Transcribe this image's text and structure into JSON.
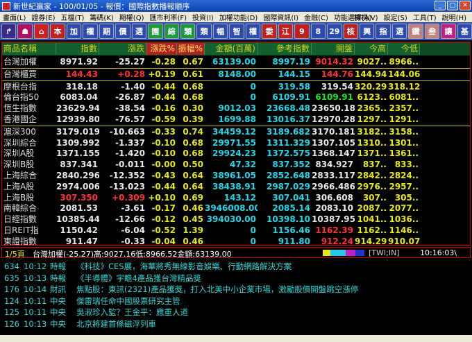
{
  "window": {
    "title": "新世紀贏家 - 100/01/05 - 報價：國際指數播報順序"
  },
  "menu": {
    "items": [
      "畫面(L)",
      "證券(E)",
      "五檔(T)",
      "籌碼(K)",
      "期權(Q)",
      "匯市利率(F)",
      "投資(I)",
      "加權功能(D)",
      "國際資訊(I)",
      "金融(C)",
      "功能選擇(A)"
    ],
    "right": [
      "檢視(V)",
      "設定(S)",
      "工具(T)",
      "說明(H)"
    ]
  },
  "toolbar": {
    "buttons": [
      {
        "label": "↱",
        "color": "#3a2a8a"
      },
      {
        "label": "☗",
        "color": "#b01060"
      },
      {
        "label": "⌂",
        "color": "#d02020"
      },
      {
        "label": "本",
        "color": "#c02020"
      },
      {
        "label": "加",
        "color": "#2c4bb0"
      },
      {
        "label": "權",
        "color": "#2c4bb0"
      },
      {
        "label": "期",
        "color": "#2c4bb0"
      },
      {
        "label": "價",
        "color": "#2c4bb0"
      },
      {
        "label": "選",
        "color": "#2c4bb0"
      },
      {
        "label": "園",
        "color": "#1a9a3a"
      },
      {
        "label": "綜",
        "color": "#1a9a3a"
      },
      {
        "label": "類",
        "color": "#1a9a3a"
      },
      {
        "label": "類",
        "color": "#2c4bb0"
      },
      {
        "label": "幅",
        "color": "#2c4bb0"
      },
      {
        "label": "智",
        "color": "#2c4bb0"
      },
      {
        "label": "權",
        "color": "#2c4bb0"
      },
      {
        "label": "委",
        "color": "#c02020"
      },
      {
        "label": "江",
        "color": "#c02020"
      },
      {
        "label": "9",
        "color": "#c02020"
      },
      {
        "label": "8",
        "color": "#2c4bb0"
      },
      {
        "label": "29",
        "color": "#2c4bb0"
      },
      {
        "label": "核",
        "color": "#c02020"
      },
      {
        "label": "興",
        "color": "#2c4bb0"
      },
      {
        "label": "指",
        "color": "#2c4bb0"
      },
      {
        "label": "選",
        "color": "#2c4bb0"
      },
      {
        "label": "鑽",
        "color": "#c08080"
      },
      {
        "label": "叁",
        "color": "#c08080"
      },
      {
        "label": "讓",
        "color": "#c02080"
      },
      {
        "label": "基",
        "color": "#2c4bb0"
      }
    ]
  },
  "table": {
    "headers": [
      "商品名稱",
      "指數",
      "漲跌",
      "漲跌%",
      "振幅%",
      "金額(百萬)",
      "參考指數",
      "開盤",
      "今高",
      "今低"
    ],
    "rows": [
      {
        "name": "台灣加權",
        "idx": "8971.92",
        "chg": "-25.27",
        "pct": "-0.28",
        "amp": "0.67",
        "amt": "63139.00",
        "ref": "8997.19",
        "open": "9014.32",
        "high": "9027..",
        "low": "8966..",
        "c": {
          "idx": "#e8e8e8",
          "chg": "#e8e8e8",
          "pct": "#e8e817",
          "amp": "#e8e817",
          "amt": "#20d8e8",
          "ref": "#20d8e8",
          "open": "#ff3333",
          "high": "#e8e817",
          "low": "#e8e817"
        }
      },
      {
        "name": "台灣櫃買",
        "idx": "144.43",
        "chg": "+0.28",
        "pct": "+0.19",
        "amp": "0.61",
        "amt": "8148.00",
        "ref": "144.15",
        "open": "144.76",
        "high": "144.94",
        "low": "144.06",
        "c": {
          "idx": "#ff3333",
          "chg": "#ff3333",
          "pct": "#e8e817",
          "amp": "#e8e817",
          "amt": "#20d8e8",
          "ref": "#20d8e8",
          "open": "#ff3333",
          "high": "#e8e817",
          "low": "#e8e817"
        }
      },
      {
        "name": "摩根台指",
        "idx": "318.18",
        "chg": "-1.40",
        "pct": "-0.44",
        "amp": "0.68",
        "amt": "0",
        "ref": "319.58",
        "open": "319.54",
        "high": "320.29",
        "low": "318.12",
        "c": {
          "idx": "#e8e8e8",
          "chg": "#e8e8e8",
          "pct": "#e8e817",
          "amp": "#e8e817",
          "amt": "#20d8e8",
          "ref": "#20d8e8",
          "open": "#e8e8e8",
          "high": "#e8e817",
          "low": "#e8e817"
        }
      },
      {
        "name": "倫台指50",
        "idx": "6083.04",
        "chg": "-26.87",
        "pct": "-0.44",
        "amp": "0.68",
        "amt": "0",
        "ref": "6109.91",
        "open": "6109.91",
        "high": "6123..",
        "low": "6081..",
        "c": {
          "idx": "#e8e8e8",
          "chg": "#e8e8e8",
          "pct": "#e8e817",
          "amp": "#e8e817",
          "amt": "#20d8e8",
          "ref": "#20d8e8",
          "open": "#22e822",
          "high": "#e8e817",
          "low": "#e8e817"
        }
      },
      {
        "name": "恆生指數",
        "idx": "23629.94",
        "chg": "-38.54",
        "pct": "-0.16",
        "amp": "0.30",
        "amt": "9012.03",
        "ref": "23668.48",
        "open": "23650.18",
        "high": "2365..",
        "low": "2357..",
        "c": {
          "idx": "#e8e8e8",
          "chg": "#e8e8e8",
          "pct": "#e8e817",
          "amp": "#e8e817",
          "amt": "#20d8e8",
          "ref": "#20d8e8",
          "open": "#e8e8e8",
          "high": "#e8e817",
          "low": "#e8e817"
        }
      },
      {
        "name": "香港國企",
        "idx": "12939.80",
        "chg": "-76.57",
        "pct": "-0.59",
        "amp": "0.39",
        "amt": "1699.88",
        "ref": "13016.37",
        "open": "12970.28",
        "high": "1297..",
        "low": "1291..",
        "c": {
          "idx": "#e8e8e8",
          "chg": "#e8e8e8",
          "pct": "#e8e817",
          "amp": "#e8e817",
          "amt": "#20d8e8",
          "ref": "#20d8e8",
          "open": "#e8e8e8",
          "high": "#e8e817",
          "low": "#e8e817"
        }
      },
      {
        "name": "滬深300",
        "idx": "3179.019",
        "chg": "-10.663",
        "pct": "-0.33",
        "amp": "0.74",
        "amt": "34459.12",
        "ref": "3189.682",
        "open": "3170.181",
        "high": "3182..",
        "low": "3158..",
        "c": {
          "idx": "#e8e8e8",
          "chg": "#e8e8e8",
          "pct": "#e8e817",
          "amp": "#e8e817",
          "amt": "#20d8e8",
          "ref": "#20d8e8",
          "open": "#e8e8e8",
          "high": "#e8e817",
          "low": "#e8e817"
        }
      },
      {
        "name": "深圳綜合",
        "idx": "1309.992",
        "chg": "-1.337",
        "pct": "-0.10",
        "amp": "0.68",
        "amt": "29971.55",
        "ref": "1311.329",
        "open": "1307.105",
        "high": "1310..",
        "low": "1301..",
        "c": {
          "idx": "#e8e8e8",
          "chg": "#e8e8e8",
          "pct": "#e8e817",
          "amp": "#e8e817",
          "amt": "#20d8e8",
          "ref": "#20d8e8",
          "open": "#e8e8e8",
          "high": "#e8e817",
          "low": "#e8e817"
        }
      },
      {
        "name": "深圳A股",
        "idx": "1371.155",
        "chg": "-1.420",
        "pct": "-0.10",
        "amp": "0.68",
        "amt": "29924.23",
        "ref": "1372.575",
        "open": "1368.147",
        "high": "1371..",
        "low": "1361..",
        "c": {
          "idx": "#e8e8e8",
          "chg": "#e8e8e8",
          "pct": "#e8e817",
          "amp": "#e8e817",
          "amt": "#20d8e8",
          "ref": "#20d8e8",
          "open": "#e8e8e8",
          "high": "#e8e817",
          "low": "#e8e817"
        }
      },
      {
        "name": "深圳B股",
        "idx": "837.341",
        "chg": "-0.011",
        "pct": "-0.00",
        "amp": "0.50",
        "amt": "47.32",
        "ref": "837.352",
        "open": "834.927",
        "high": "837..",
        "low": "833..",
        "c": {
          "idx": "#e8e8e8",
          "chg": "#e8e8e8",
          "pct": "#e8e817",
          "amp": "#e8e817",
          "amt": "#20d8e8",
          "ref": "#20d8e8",
          "open": "#e8e8e8",
          "high": "#e8e817",
          "low": "#e8e817"
        }
      },
      {
        "name": "上海綜合",
        "idx": "2840.296",
        "chg": "-12.352",
        "pct": "-0.43",
        "amp": "0.64",
        "amt": "38961.05",
        "ref": "2852.648",
        "open": "2833.117",
        "high": "2842..",
        "low": "2824..",
        "c": {
          "idx": "#e8e8e8",
          "chg": "#e8e8e8",
          "pct": "#e8e817",
          "amp": "#e8e817",
          "amt": "#20d8e8",
          "ref": "#20d8e8",
          "open": "#e8e8e8",
          "high": "#e8e817",
          "low": "#e8e817"
        }
      },
      {
        "name": "上海A股",
        "idx": "2974.006",
        "chg": "-13.023",
        "pct": "-0.44",
        "amp": "0.64",
        "amt": "38438.91",
        "ref": "2987.029",
        "open": "2966.486",
        "high": "2976..",
        "low": "2957..",
        "c": {
          "idx": "#e8e8e8",
          "chg": "#e8e8e8",
          "pct": "#e8e817",
          "amp": "#e8e817",
          "amt": "#20d8e8",
          "ref": "#20d8e8",
          "open": "#e8e8e8",
          "high": "#e8e817",
          "low": "#e8e817"
        }
      },
      {
        "name": "上海B股",
        "idx": "307.350",
        "chg": "+0.309",
        "pct": "+0.10",
        "amp": "0.69",
        "amt": "143.12",
        "ref": "307.041",
        "open": "306.608",
        "high": "307..",
        "low": "305..",
        "c": {
          "idx": "#ff3333",
          "chg": "#ff3333",
          "pct": "#e8e817",
          "amp": "#e8e817",
          "amt": "#20d8e8",
          "ref": "#20d8e8",
          "open": "#e8e8e8",
          "high": "#e8e817",
          "low": "#e8e817"
        }
      },
      {
        "name": "南韓綜合",
        "idx": "2081.53",
        "chg": "-3.61",
        "pct": "-0.17",
        "amp": "0.46",
        "amt": "3946008.00",
        "ref": "2085.14",
        "open": "2083.10",
        "high": "2087..",
        "low": "2077..",
        "c": {
          "idx": "#e8e8e8",
          "chg": "#e8e8e8",
          "pct": "#e8e817",
          "amp": "#e8e817",
          "amt": "#20d8e8",
          "ref": "#20d8e8",
          "open": "#e8e8e8",
          "high": "#e8e817",
          "low": "#e8e817"
        }
      },
      {
        "name": "日經指數",
        "idx": "10385.44",
        "chg": "-12.66",
        "pct": "-0.12",
        "amp": "0.45",
        "amt": "394030.00",
        "ref": "10398.10",
        "open": "10387.95",
        "high": "1041..",
        "low": "1036..",
        "c": {
          "idx": "#e8e8e8",
          "chg": "#e8e8e8",
          "pct": "#e8e817",
          "amp": "#e8e817",
          "amt": "#20d8e8",
          "ref": "#20d8e8",
          "open": "#e8e8e8",
          "high": "#e8e817",
          "low": "#e8e817"
        }
      },
      {
        "name": "日REIT指",
        "idx": "1150.42",
        "chg": "-6.04",
        "pct": "-0.52",
        "amp": "1.39",
        "amt": "0",
        "ref": "1156.46",
        "open": "1162.39",
        "high": "1162..",
        "low": "1146..",
        "c": {
          "idx": "#e8e8e8",
          "chg": "#e8e8e8",
          "pct": "#e8e817",
          "amp": "#e8e817",
          "amt": "#20d8e8",
          "ref": "#20d8e8",
          "open": "#ff3333",
          "high": "#e8e817",
          "low": "#e8e817"
        }
      },
      {
        "name": "東證指數",
        "idx": "911.47",
        "chg": "-0.33",
        "pct": "-0.04",
        "amp": "0.46",
        "amt": "0",
        "ref": "911.80",
        "open": "912.24",
        "high": "914.29",
        "low": "910.07",
        "c": {
          "idx": "#e8e8e8",
          "chg": "#e8e8e8",
          "pct": "#e8e817",
          "amp": "#e8e817",
          "amt": "#20d8e8",
          "ref": "#20d8e8",
          "open": "#ff3333",
          "high": "#e8e817",
          "low": "#e8e817"
        }
      }
    ]
  },
  "status": {
    "page": "1/5頁",
    "ticker": "台灣加權(-25.27)高:9027.16低:8966.52金額:63139.00",
    "market": "[TWI;IN]",
    "time": "10:16:03\\"
  },
  "news": [
    {
      "id": "634",
      "time": "10:12",
      "src": "時報",
      "text": "《科技》CES展，海華將秀無線影音娛樂、行動網路解決方案"
    },
    {
      "id": "635",
      "time": "10:13",
      "src": "時報",
      "text": "《半導體》宇瞻4產品獲台灣精品獎"
    },
    {
      "id": "176",
      "time": "10:14",
      "src": "財訊",
      "text": "焦點股：東訊(2321)產品獲獎，打入北美中小企業市場，激勵股價開盤跳空漲停"
    },
    {
      "id": "124",
      "time": "10:11",
      "src": "中央",
      "text": "傑雷瑞任命中國股票研究主管"
    },
    {
      "id": "125",
      "time": "10:11",
      "src": "中央",
      "text": "吳淑珍入監？王金平：應重人道"
    },
    {
      "id": "126",
      "time": "10:13",
      "src": "中央",
      "text": "北京將建首條磁浮列車"
    }
  ]
}
